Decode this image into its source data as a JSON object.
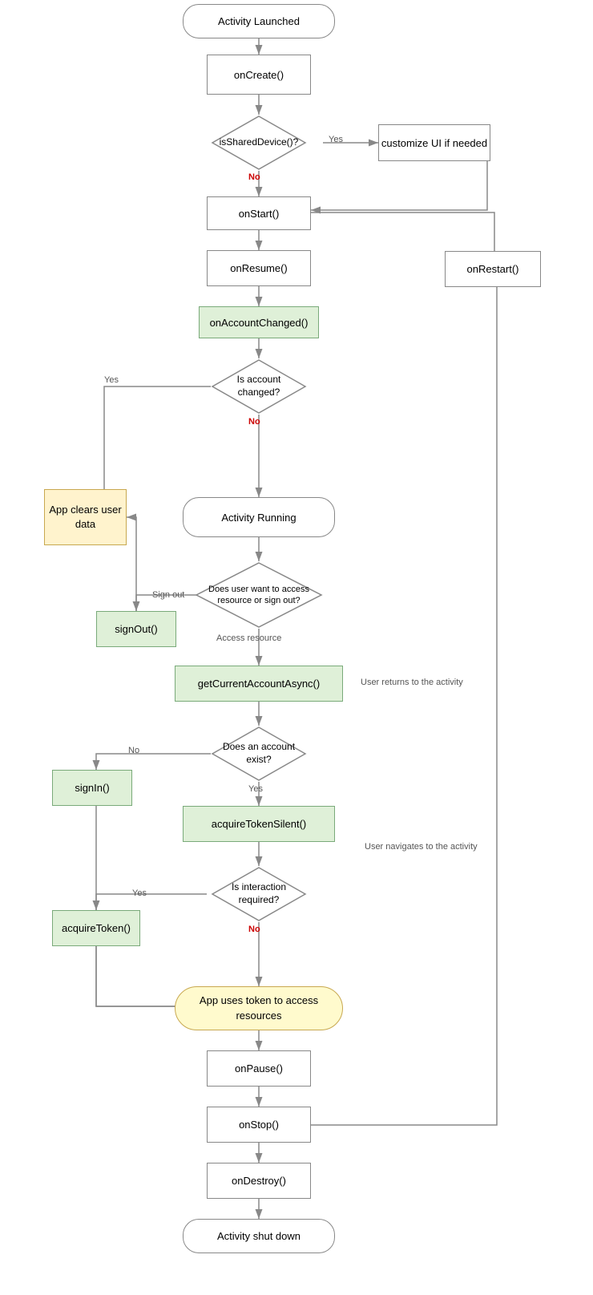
{
  "nodes": {
    "activity_launched": {
      "label": "Activity Launched"
    },
    "on_create": {
      "label": "onCreate()"
    },
    "is_shared_device": {
      "label": "isSharedDevice()?"
    },
    "customize_ui": {
      "label": "customize UI if needed"
    },
    "on_start": {
      "label": "onStart()"
    },
    "on_resume": {
      "label": "onResume()"
    },
    "on_account_changed": {
      "label": "onAccountChanged()"
    },
    "is_account_changed": {
      "label": "Is account changed?"
    },
    "app_clears": {
      "label": "App clears user data"
    },
    "activity_running": {
      "label": "Activity Running"
    },
    "sign_out_q": {
      "label": "Does user want to access resource or sign out?"
    },
    "sign_out": {
      "label": "signOut()"
    },
    "get_current": {
      "label": "getCurrentAccountAsync()"
    },
    "does_account_exist": {
      "label": "Does an account exist?"
    },
    "sign_in": {
      "label": "signIn()"
    },
    "acquire_silent": {
      "label": "acquireTokenSilent()"
    },
    "is_interaction": {
      "label": "Is interaction required?"
    },
    "acquire_token": {
      "label": "acquireToken()"
    },
    "app_uses_token": {
      "label": "App uses token to access resources"
    },
    "on_pause": {
      "label": "onPause()"
    },
    "on_stop": {
      "label": "onStop()"
    },
    "on_destroy": {
      "label": "onDestroy()"
    },
    "activity_shutdown": {
      "label": "Activity shut down"
    },
    "on_restart": {
      "label": "onRestart()"
    }
  },
  "labels": {
    "yes": "Yes",
    "no": "No",
    "sign_out_text": "Sign out",
    "access_resource": "Access resource",
    "user_returns": "User returns to the activity",
    "user_navigates": "User navigates to the activity"
  }
}
